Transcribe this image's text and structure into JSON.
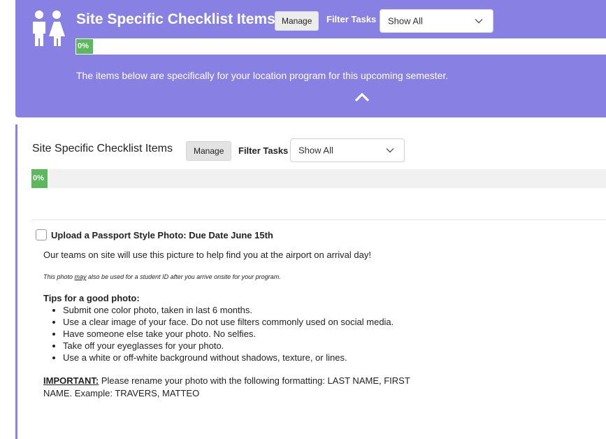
{
  "hero": {
    "title": "Site Specific Checklist Items",
    "manage_label": "Manage",
    "filter_label": "Filter Tasks",
    "filter_value": "Show All",
    "progress_text": "0%",
    "progress_fraction": 0,
    "subtitle": "The items below are specifically for your location program for this upcoming semester.",
    "icon": "people-icon",
    "collapse_icon": "chevron-up-icon",
    "background_color": "#8880e3"
  },
  "card": {
    "title": "Site Specific Checklist Items",
    "manage_label": "Manage",
    "filter_label": "Filter Tasks",
    "filter_value": "Show All",
    "progress_text": "0%",
    "progress_fraction": 0,
    "progress_color": "#5cb85c"
  },
  "task": {
    "checked": false,
    "title": "Upload a Passport Style Photo: Due Date June 15th",
    "description": "Our teams on site will use this picture to help find you at the airport on arrival day!",
    "note_prefix": "This photo ",
    "note_emphasis": "may",
    "note_suffix": " also be used for a student ID after you arrive onsite for your program.",
    "tips_heading": "Tips for a good photo:",
    "tips": [
      "Submit one color photo, taken in last 6 months.",
      "Use a clear image of your face. Do not use filters commonly used on social media.",
      "Have someone else take your photo. No selfies.",
      "Take off your eyeglasses for your photo.",
      "Use a white or off-white background without shadows, texture, or lines."
    ],
    "important_label": "IMPORTANT:",
    "important_text": " Please rename your photo with the following formatting: LAST NAME, FIRST NAME. Example: TRAVERS, MATTEO"
  }
}
